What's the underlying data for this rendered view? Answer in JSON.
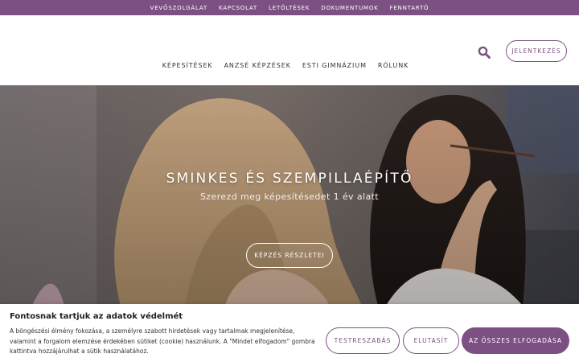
{
  "colors": {
    "brand": "#7d5083",
    "white": "#ffffff"
  },
  "topbar": {
    "links": [
      "VEVŐSZOLGÁLAT",
      "KAPCSOLAT",
      "LETÖLTÉSEK",
      "DOKUMENTUMOK",
      "FENNTARTÓ"
    ]
  },
  "header": {
    "search_icon": "search-icon",
    "login_label": "JELENTKEZÉS",
    "nav": [
      "KÉPESÍTÉSEK",
      "ANZSÉ KÉPZÉSEK",
      "ESTI GIMNÁZIUM",
      "RÓLUNK"
    ]
  },
  "hero": {
    "title": "SMINKES ÉS SZEMPILLAÉPÍTŐ",
    "subtitle": "Szerezd meg képesítésedet 1 év alatt",
    "button_label": "KÉPZÉS RÉSZLETEI"
  },
  "cookie": {
    "title": "Fontosnak tartjuk az adatok védelmét",
    "text": "A böngészési élmény fokozása, a személyre szabott hirdetések vagy tartalmak megjelenítése, valamint a forgalom elemzése érdekében sütiket (cookie) használunk. A \"Mindet elfogadom\" gombra kattintva hozzájárulhat a sütik használatához.",
    "customize_label": "TESTRESZABÁS",
    "reject_label": "ELUTASÍT",
    "accept_label": "AZ ÖSSZES ELFOGADÁSA"
  }
}
